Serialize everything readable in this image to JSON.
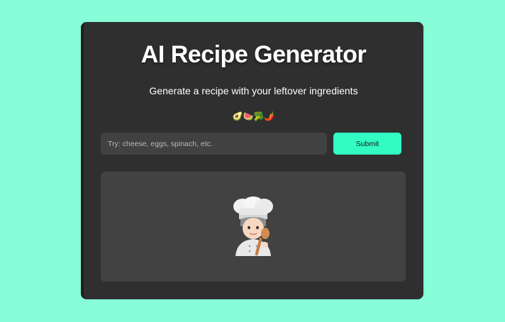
{
  "header": {
    "title": "AI Recipe Generator",
    "subtitle": "Generate a recipe with your leftover ingredients",
    "emojis": "🥑🍉🥦🌶️"
  },
  "search": {
    "placeholder": "Try: cheese, eggs, spinach, etc.",
    "value": ""
  },
  "submit": {
    "label": "Submit"
  },
  "result": {
    "illustration_icon": "chef-icon"
  },
  "colors": {
    "background": "#86fcd7",
    "card": "#2f2f2f",
    "input": "#414141",
    "accent": "#32fcc3",
    "panel": "#424242"
  }
}
